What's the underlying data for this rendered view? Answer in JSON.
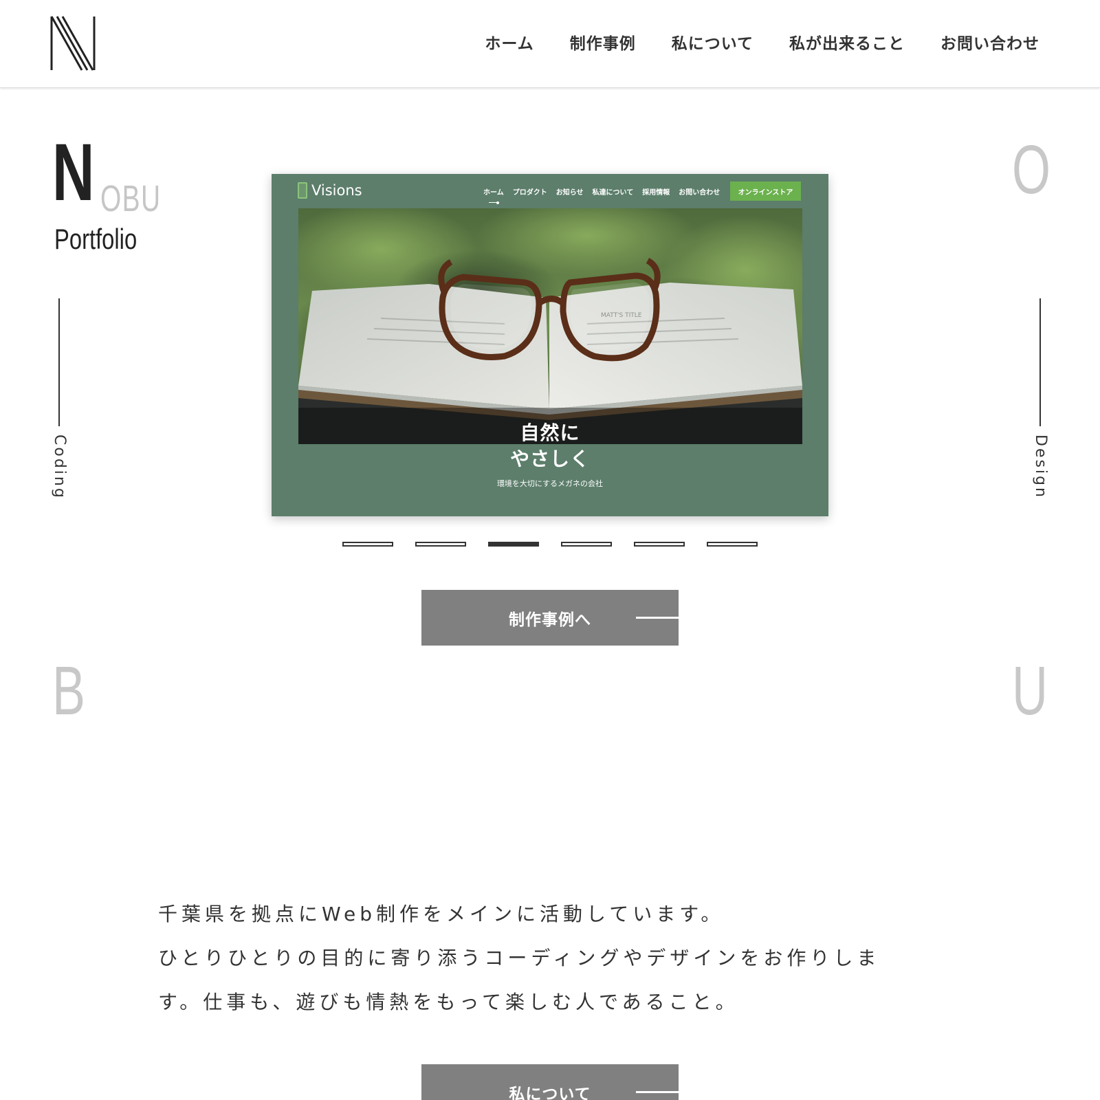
{
  "nav": {
    "items": [
      "ホーム",
      "制作事例",
      "私について",
      "私が出来ること",
      "お問い合わせ"
    ]
  },
  "brand": {
    "initial": "N",
    "rest": "OBU",
    "subtitle": "Portfolio"
  },
  "side_letters": {
    "top_right": "O",
    "bottom_left": "B",
    "bottom_right": "U"
  },
  "side_labels": {
    "left": "Coding",
    "right": "Design"
  },
  "slide": {
    "logo_text": "Visions",
    "nav": [
      "ホーム",
      "プロダクト",
      "お知らせ",
      "私達について",
      "採用情報",
      "お問い合わせ"
    ],
    "cta": "オンラインストア",
    "title_line1": "自然に",
    "title_line2": "やさしく",
    "subtitle": "環境を大切にするメガネの会社",
    "book_text": "MATT'S TITLE"
  },
  "slider": {
    "count": 6,
    "active_index": 2
  },
  "buttons": {
    "works": "制作事例へ",
    "about": "私について"
  },
  "intro": {
    "lines": [
      "千葉県を拠点にWeb制作をメインに活動しています。",
      "ひとりひとりの目的に寄り添うコーディングやデザインをお作りしま",
      "す。仕事も、遊びも情熱をもって楽しむ人であること。"
    ]
  },
  "colors": {
    "text": "#333333",
    "slide_bg": "#5c7e6b",
    "cta_green": "#6bb14e",
    "button_gray": "#808080",
    "letter_gray": "#c8c8c8"
  }
}
